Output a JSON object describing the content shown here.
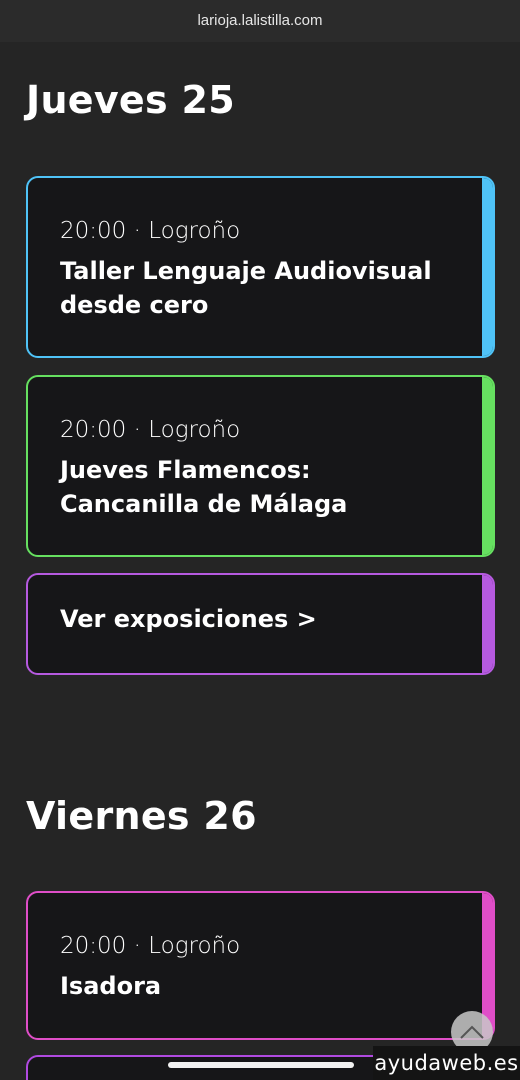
{
  "browser": {
    "url": "larioja.lalistilla.com"
  },
  "days": [
    {
      "heading": "Jueves 25",
      "events": [
        {
          "meta": "20:00 · Logroño",
          "title": "Taller Lenguaje Audiovisual desde cero",
          "color": "#4fc3f7"
        },
        {
          "meta": "20:00 · Logroño",
          "title": "Jueves Flamencos: Cancanilla de Málaga",
          "color": "#66e060"
        }
      ],
      "link": {
        "label": "Ver exposiciones >",
        "color": "#b65ae0"
      }
    },
    {
      "heading": "Viernes 26",
      "events": [
        {
          "meta": "20:00 · Logroño",
          "title": "Isadora",
          "color": "#e04ec8"
        }
      ]
    }
  ],
  "next_card_color": "#b04ae0",
  "scroll_top_icon": "chevron-up-icon",
  "watermark": "ayudaweb.es"
}
